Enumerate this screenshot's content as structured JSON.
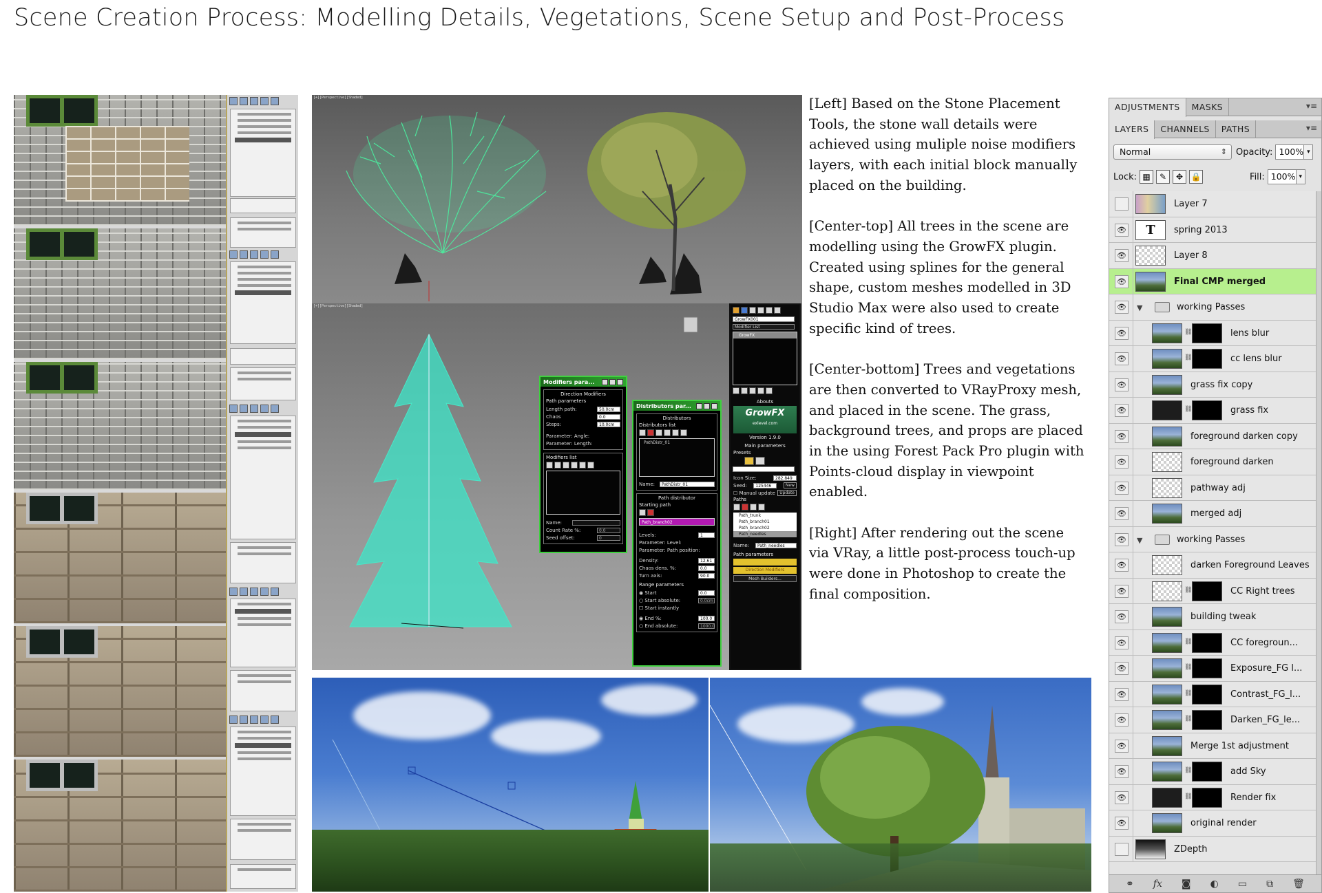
{
  "page": {
    "title": "Scene Creation Process: Modelling Details, Vegetations, Scene Setup and Post-Process"
  },
  "left": {
    "viewport_count": 6
  },
  "growfx": {
    "viewport_labels": [
      "[+][Perspective][Shaded]",
      "[+][Perspective][Shaded]"
    ],
    "modifiers_dialog": {
      "title": "Modifiers para...",
      "group": "Direction Modifiers",
      "subgroup": "Path parameters",
      "rows": [
        {
          "label": "Length path:",
          "value": "50.0cm"
        },
        {
          "label": "Chaos",
          "value": "0.0"
        },
        {
          "label": "Steps:",
          "value": "10.0cm"
        }
      ],
      "param_angle": "Parameter: Angle:",
      "param_length": "Parameter: Length:",
      "modifiers_list": "Modifiers list",
      "name_label": "Name:",
      "count_rate": "Count Rate %:",
      "count_rate_value": "0.0",
      "seed_offset": "Seed offset:",
      "seed_offset_value": "0"
    },
    "distributors_dialog": {
      "title": "Distributors par...",
      "group": "Distributors",
      "list_label": "Distributors list",
      "list_item": "PathDistr_01",
      "name_label": "Name:",
      "name_value": "PathDistr_01",
      "path_distributor": "Path distributor",
      "starting_path": "Starting path",
      "starting_path_value": "Path_branch02",
      "levels_label": "Levels:",
      "levels_value": "1",
      "param_level": "Parameter: Level:",
      "param_path_position": "Parameter: Path position:",
      "density_label": "Density:",
      "density_value": "12.61",
      "chaos_dens_label": "Chaos dens. %:",
      "chaos_dens_value": "0.0",
      "turn_axis_label": "Turn axis:",
      "turn_axis_value": "90.0",
      "range_params": "Range parameters",
      "start": "Start",
      "start_value": "0.0",
      "start_absolute": "Start absolute:",
      "start_absolute_value": "0.0cm",
      "start_instantly": "Start instantly",
      "end_pct": "End %:",
      "end_pct_value": "100.0",
      "end_absolute": "End absolute:",
      "end_absolute_value": "1000.0"
    },
    "command_panel": {
      "object_name": "GrowFX001",
      "modifier_list": "Modifier List",
      "stack_item": "GrowFX",
      "abouts": "Abouts",
      "logo": "GrowFX",
      "logo_sub": "exlevel.com",
      "version": "Version 1.9.0",
      "main_params": "Main parameters",
      "presets": "Presets",
      "icon_size_label": "Icon Size:",
      "icon_size_value": "282.849",
      "seed_label": "Seed:",
      "seed_value": "125446",
      "new_btn": "New",
      "manual_update": "Manual update",
      "update_btn": "Update",
      "paths_label": "Paths",
      "paths": [
        "Path_trunk",
        "Path_branch01",
        "Path_branch02",
        "Path_needles"
      ],
      "name_label": "Name:",
      "name_value": "Path_needles",
      "path_params": "Path parameters",
      "direction_modifiers": "Direction Modifiers",
      "mesh_builders": "Mesh Builders..."
    }
  },
  "description": {
    "paragraphs": [
      "[Left] Based on the Stone Placement Tools, the stone wall details were achieved using muliple noise modifiers layers, with each initial block manually placed on the building.",
      "[Center-top] All trees in the scene are modelling using the GrowFX plugin. Created using splines for the general shape, custom meshes modelled in 3D Studio Max were also used to create specific kind of trees.",
      "[Center-bottom] Trees and vegetations are then converted to VRayProxy mesh, and placed in the scene. The grass, background trees, and props are placed in the using Forest Pack Pro plugin with Points-cloud display in viewpoint enabled.",
      "[Right] After rendering out the scene via VRay, a little post-process touch-up were done in Photoshop to create the final composition."
    ]
  },
  "photoshop": {
    "tabs_top": [
      "ADJUSTMENTS",
      "MASKS"
    ],
    "tabs_layers": [
      "LAYERS",
      "CHANNELS",
      "PATHS"
    ],
    "blend_mode": "Normal",
    "opacity_label": "Opacity:",
    "opacity_value": "100%",
    "lock_label": "Lock:",
    "fill_label": "Fill:",
    "fill_value": "100%",
    "layers": [
      {
        "name": "Layer 7",
        "visible": false,
        "thumb": "colorful",
        "indent": 0
      },
      {
        "name": "spring 2013",
        "visible": true,
        "thumb": "text",
        "indent": 0
      },
      {
        "name": "Layer 8",
        "visible": true,
        "thumb": "check",
        "indent": 0
      },
      {
        "name": "Final CMP merged",
        "visible": true,
        "thumb": "photo",
        "indent": 0,
        "selected": true
      },
      {
        "name": "working Passes",
        "visible": true,
        "group": true
      },
      {
        "name": "lens blur",
        "visible": true,
        "thumb": "photo",
        "mask": "half",
        "indent": 1
      },
      {
        "name": "cc lens blur",
        "visible": true,
        "thumb": "photo",
        "mask": "half",
        "indent": 1
      },
      {
        "name": "grass fix copy",
        "visible": true,
        "thumb": "photo",
        "indent": 1
      },
      {
        "name": "grass fix",
        "visible": true,
        "thumb": "dark",
        "mask": "spots",
        "indent": 1
      },
      {
        "name": "foreground darken copy",
        "visible": true,
        "thumb": "photo",
        "indent": 1
      },
      {
        "name": "foreground darken",
        "visible": true,
        "thumb": "check",
        "indent": 1
      },
      {
        "name": "pathway adj",
        "visible": true,
        "thumb": "check",
        "indent": 1
      },
      {
        "name": "merged adj",
        "visible": true,
        "thumb": "photo",
        "indent": 1
      },
      {
        "name": "working Passes",
        "visible": true,
        "group": true
      },
      {
        "name": "darken Foreground Leaves",
        "visible": true,
        "thumb": "check",
        "indent": 1
      },
      {
        "name": "CC Right trees",
        "visible": true,
        "thumb": "check",
        "mask": "sky",
        "indent": 1
      },
      {
        "name": "building tweak",
        "visible": true,
        "thumb": "photo",
        "indent": 1
      },
      {
        "name": "CC foregroun...",
        "visible": true,
        "thumb": "photo",
        "mask": "half",
        "indent": 1
      },
      {
        "name": "Exposure_FG l...",
        "visible": true,
        "thumb": "photo",
        "mask": "half",
        "indent": 1
      },
      {
        "name": "Contrast_FG_l...",
        "visible": true,
        "thumb": "photo",
        "mask": "half",
        "indent": 1
      },
      {
        "name": "Darken_FG_le...",
        "visible": true,
        "thumb": "photo",
        "mask": "half",
        "indent": 1
      },
      {
        "name": "Merge 1st adjustment",
        "visible": true,
        "thumb": "photo",
        "indent": 1
      },
      {
        "name": "add Sky",
        "visible": true,
        "thumb": "photo",
        "mask": "sky",
        "indent": 1
      },
      {
        "name": "Render fix",
        "visible": true,
        "thumb": "dark",
        "mask": "black",
        "indent": 1
      },
      {
        "name": "original render",
        "visible": true,
        "thumb": "photo",
        "indent": 1
      },
      {
        "name": "ZDepth",
        "visible": false,
        "thumb": "depth",
        "indent": 0
      }
    ]
  }
}
